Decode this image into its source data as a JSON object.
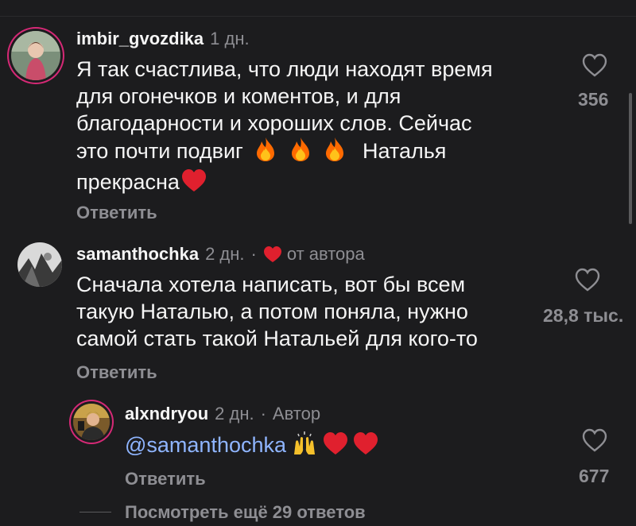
{
  "comments": [
    {
      "username": "imbir_gvozdika",
      "time": "1 дн.",
      "text_line1": "Я так счастлива, что люди находят время",
      "text_line2": "для огонечков и коментов, и для",
      "text_line3": "благодарности и хороших слов. Сейчас",
      "text_line4_a": "это почти подвиг",
      "text_line4_b": "Наталья",
      "text_line5": "прекрасна",
      "reply_label": "Ответить",
      "like_count": "356"
    },
    {
      "username": "samanthochka",
      "time": "2 дн.",
      "author_badge": "от автора",
      "text_line1": "Сначала хотела написать, вот бы всем",
      "text_line2": "такую Наталью, а потом поняла, нужно",
      "text_line3": "самой стать такой Натальей для кого-то",
      "reply_label": "Ответить",
      "like_count": "28,8 тыс."
    },
    {
      "username": "alxndryou",
      "time": "2 дн.",
      "role": "Автор",
      "mention": "@samanthochka",
      "reply_label": "Ответить",
      "like_count": "677"
    }
  ],
  "view_more": "Посмотреть ещё 29 ответов",
  "icons": {
    "like": "heart-outline-icon",
    "fire": "fire-emoji-icon",
    "heart": "red-heart-emoji-icon",
    "hands": "raised-hands-emoji-icon"
  },
  "colors": {
    "background": "#1c1c1e",
    "text": "#f5f5f5",
    "muted": "#8e8e93",
    "mention": "#8fb5ff",
    "heart": "#e0202e",
    "story_ring": "#d62976"
  }
}
